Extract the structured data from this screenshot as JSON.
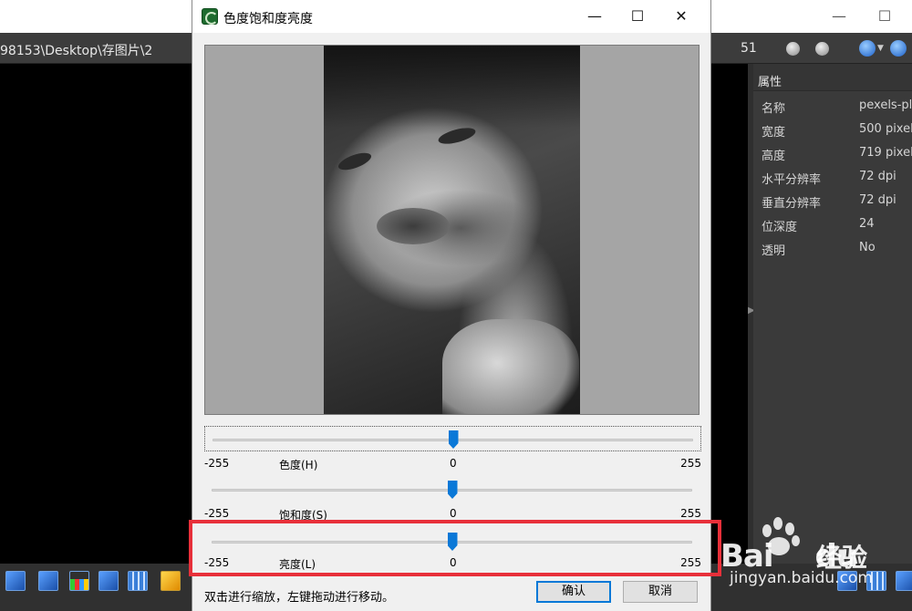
{
  "app": {
    "path": "98153\\Desktop\\存图片\\2",
    "count": "51",
    "minimize_glyph": "—",
    "restore_glyph": "☐"
  },
  "properties": {
    "title": "属性",
    "rows": [
      {
        "key": "名称",
        "value": "pexels-pl"
      },
      {
        "key": "宽度",
        "value": "500 pixel"
      },
      {
        "key": "高度",
        "value": "719 pixel"
      },
      {
        "key": "水平分辨率",
        "value": "72 dpi"
      },
      {
        "key": "垂直分辨率",
        "value": "72 dpi"
      },
      {
        "key": "位深度",
        "value": "24"
      },
      {
        "key": "透明",
        "value": "No"
      }
    ]
  },
  "dialog": {
    "title": "色度饱和度亮度",
    "minimize_glyph": "—",
    "maximize_glyph": "☐",
    "close_glyph": "✕",
    "sliders": [
      {
        "name": "色度(H)",
        "min": "-255",
        "mid": "0",
        "max": "255",
        "value": 0
      },
      {
        "name": "饱和度(S)",
        "min": "-255",
        "mid": "0",
        "max": "255",
        "value": 0
      },
      {
        "name": "亮度(L)",
        "min": "-255",
        "mid": "0",
        "max": "255",
        "value": 0
      }
    ],
    "hint": "双击进行缩放，左键拖动进行移动。",
    "ok_label": "确认",
    "cancel_label": "取消"
  },
  "watermark": {
    "brand": "Bai",
    "brand2": "du",
    "cn": "经验",
    "url": "jingyan.baidu.com"
  },
  "colors": {
    "accent": "#0a78d7",
    "highlight": "#e8303a"
  }
}
